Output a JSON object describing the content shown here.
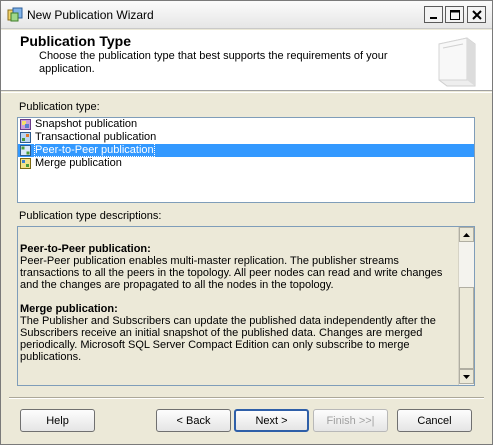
{
  "window": {
    "title": "New Publication Wizard"
  },
  "header": {
    "title": "Publication Type",
    "description": "Choose the publication type that best supports the requirements of your application."
  },
  "publication_type": {
    "label": "Publication type:",
    "items": [
      {
        "label": "Snapshot publication",
        "icon": "snapshot-publication-icon",
        "selected": false
      },
      {
        "label": "Transactional publication",
        "icon": "transactional-publication-icon",
        "selected": false
      },
      {
        "label": "Peer-to-Peer publication",
        "icon": "peer-to-peer-publication-icon",
        "selected": true
      },
      {
        "label": "Merge publication",
        "icon": "merge-publication-icon",
        "selected": false
      }
    ]
  },
  "descriptions": {
    "label": "Publication type descriptions:",
    "entries": [
      {
        "heading": "Peer-to-Peer publication:",
        "text": "Peer-Peer publication enables multi-master replication. The publisher streams transactions to all the peers in the topology. All peer nodes can read and write changes and the changes are propagated to all the nodes in the topology."
      },
      {
        "heading": "Merge publication:",
        "text": "The Publisher and Subscribers can update the published data independently after the Subscribers receive an initial snapshot of the published data. Changes are merged periodically. Microsoft SQL Server Compact Edition can only subscribe to merge publications."
      }
    ]
  },
  "buttons": {
    "help": "Help",
    "back": "< Back",
    "next": "Next >",
    "finish": "Finish >>|",
    "cancel": "Cancel"
  },
  "colors": {
    "selection": "#3399ff",
    "default_button_border": "#2f5fa8",
    "dialog_background": "#ece9d8"
  }
}
